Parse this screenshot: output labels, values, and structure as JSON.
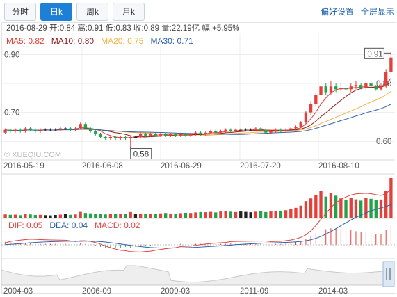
{
  "tabs": [
    {
      "label": "分时",
      "active": false
    },
    {
      "label": "日k",
      "active": true
    },
    {
      "label": "周k",
      "active": false
    },
    {
      "label": "月k",
      "active": false
    }
  ],
  "links": {
    "preferences": "偏好设置",
    "fullscreen": "全屏显示"
  },
  "info": {
    "date": "2016-08-29",
    "open_label": "开:",
    "open": "0.84",
    "high_label": "高:",
    "high": "0.91",
    "low_label": "低:",
    "low": "0.83",
    "close_label": "收:",
    "close": "0.89",
    "volume_label": "量:",
    "volume": "22.19亿",
    "change_label": "幅:",
    "change": "+5.95%"
  },
  "ma": [
    {
      "label": "MA5: 0.82",
      "color": "#e0413b"
    },
    {
      "label": "MA10: 0.80",
      "color": "#8b1a1a"
    },
    {
      "label": "MA20: 0.75",
      "color": "#f5b041"
    },
    {
      "label": "MA30: 0.71",
      "color": "#2e5fa8"
    }
  ],
  "macd": [
    {
      "label": "DIF: 0.05",
      "color": "#e0413b"
    },
    {
      "label": "DEA: 0.04",
      "color": "#2e5fa8"
    },
    {
      "label": "MACD: 0.02",
      "color": "#e0413b"
    }
  ],
  "watermark": "© XUEQIU.COM",
  "colors": {
    "up": "#e0413b",
    "down": "#22a34a",
    "flat": "#222222",
    "grid": "#ececec"
  },
  "chart_data": {
    "type": "candlestick",
    "ylim": [
      0.55,
      0.93
    ],
    "y_ticks": [
      0.9,
      0.8,
      0.7,
      0.6
    ],
    "y_tick_labels": [
      "0.90",
      "0.80",
      "0.70",
      "0.60"
    ],
    "x_tick_labels": [
      "2016-05-19",
      "2016-06-08",
      "2016-06-29",
      "2016-07-20",
      "2016-08-10"
    ],
    "markers": {
      "max": "0.91",
      "min": "0.58"
    },
    "bottom_axis_labels": [
      "2004-03",
      "2006-09",
      "2009-03",
      "2011-09",
      "2014-03"
    ],
    "candles": [
      [
        0.63,
        0.64,
        0.625,
        0.645
      ],
      [
        0.64,
        0.635,
        0.63,
        0.645
      ],
      [
        0.635,
        0.64,
        0.63,
        0.645
      ],
      [
        0.64,
        0.635,
        0.63,
        0.645
      ],
      [
        0.635,
        0.645,
        0.63,
        0.65
      ],
      [
        0.645,
        0.64,
        0.635,
        0.65
      ],
      [
        0.64,
        0.635,
        0.63,
        0.645
      ],
      [
        0.635,
        0.64,
        0.63,
        0.645
      ],
      [
        0.64,
        0.64,
        0.635,
        0.645
      ],
      [
        0.64,
        0.64,
        0.635,
        0.645
      ],
      [
        0.64,
        0.64,
        0.635,
        0.645
      ],
      [
        0.64,
        0.645,
        0.635,
        0.65
      ],
      [
        0.645,
        0.645,
        0.64,
        0.65
      ],
      [
        0.645,
        0.64,
        0.635,
        0.65
      ],
      [
        0.64,
        0.645,
        0.635,
        0.65
      ],
      [
        0.645,
        0.66,
        0.64,
        0.665
      ],
      [
        0.66,
        0.645,
        0.64,
        0.665
      ],
      [
        0.645,
        0.635,
        0.63,
        0.65
      ],
      [
        0.635,
        0.625,
        0.62,
        0.64
      ],
      [
        0.625,
        0.615,
        0.61,
        0.63
      ],
      [
        0.615,
        0.61,
        0.605,
        0.62
      ],
      [
        0.61,
        0.615,
        0.605,
        0.62
      ],
      [
        0.615,
        0.61,
        0.605,
        0.62
      ],
      [
        0.61,
        0.615,
        0.605,
        0.62
      ],
      [
        0.615,
        0.61,
        0.605,
        0.62
      ],
      [
        0.61,
        0.615,
        0.58,
        0.62
      ],
      [
        0.615,
        0.615,
        0.61,
        0.62
      ],
      [
        0.615,
        0.625,
        0.61,
        0.63
      ],
      [
        0.625,
        0.62,
        0.615,
        0.63
      ],
      [
        0.62,
        0.625,
        0.615,
        0.63
      ],
      [
        0.625,
        0.62,
        0.615,
        0.63
      ],
      [
        0.62,
        0.625,
        0.615,
        0.63
      ],
      [
        0.625,
        0.62,
        0.615,
        0.63
      ],
      [
        0.62,
        0.625,
        0.615,
        0.63
      ],
      [
        0.625,
        0.62,
        0.615,
        0.63
      ],
      [
        0.62,
        0.625,
        0.615,
        0.63
      ],
      [
        0.625,
        0.62,
        0.615,
        0.63
      ],
      [
        0.62,
        0.625,
        0.615,
        0.63
      ],
      [
        0.625,
        0.63,
        0.62,
        0.635
      ],
      [
        0.63,
        0.625,
        0.62,
        0.635
      ],
      [
        0.625,
        0.63,
        0.62,
        0.635
      ],
      [
        0.63,
        0.635,
        0.625,
        0.64
      ],
      [
        0.635,
        0.63,
        0.625,
        0.64
      ],
      [
        0.63,
        0.635,
        0.625,
        0.64
      ],
      [
        0.635,
        0.64,
        0.63,
        0.645
      ],
      [
        0.64,
        0.635,
        0.63,
        0.645
      ],
      [
        0.635,
        0.64,
        0.63,
        0.645
      ],
      [
        0.64,
        0.64,
        0.635,
        0.645
      ],
      [
        0.64,
        0.64,
        0.635,
        0.645
      ],
      [
        0.64,
        0.64,
        0.635,
        0.645
      ],
      [
        0.64,
        0.645,
        0.635,
        0.65
      ],
      [
        0.645,
        0.64,
        0.635,
        0.65
      ],
      [
        0.64,
        0.63,
        0.625,
        0.645
      ],
      [
        0.63,
        0.635,
        0.625,
        0.64
      ],
      [
        0.635,
        0.64,
        0.63,
        0.645
      ],
      [
        0.64,
        0.635,
        0.63,
        0.645
      ],
      [
        0.635,
        0.64,
        0.63,
        0.645
      ],
      [
        0.64,
        0.645,
        0.635,
        0.65
      ],
      [
        0.645,
        0.65,
        0.64,
        0.655
      ],
      [
        0.65,
        0.665,
        0.645,
        0.67
      ],
      [
        0.665,
        0.7,
        0.66,
        0.705
      ],
      [
        0.7,
        0.73,
        0.69,
        0.74
      ],
      [
        0.73,
        0.76,
        0.72,
        0.77
      ],
      [
        0.76,
        0.79,
        0.75,
        0.8
      ],
      [
        0.79,
        0.77,
        0.76,
        0.8
      ],
      [
        0.77,
        0.79,
        0.76,
        0.81
      ],
      [
        0.79,
        0.78,
        0.77,
        0.8
      ],
      [
        0.78,
        0.785,
        0.77,
        0.8
      ],
      [
        0.785,
        0.78,
        0.77,
        0.795
      ],
      [
        0.78,
        0.79,
        0.77,
        0.8
      ],
      [
        0.79,
        0.795,
        0.78,
        0.81
      ],
      [
        0.795,
        0.785,
        0.78,
        0.8
      ],
      [
        0.785,
        0.8,
        0.78,
        0.81
      ],
      [
        0.8,
        0.79,
        0.78,
        0.81
      ],
      [
        0.79,
        0.78,
        0.775,
        0.795
      ],
      [
        0.78,
        0.79,
        0.775,
        0.8
      ],
      [
        0.79,
        0.84,
        0.785,
        0.85
      ],
      [
        0.84,
        0.89,
        0.83,
        0.91
      ]
    ],
    "volumes": [
      22,
      20,
      21,
      18,
      24,
      22,
      19,
      20,
      18,
      17,
      19,
      21,
      23,
      20,
      22,
      36,
      30,
      28,
      26,
      24,
      22,
      25,
      23,
      27,
      26,
      35,
      24,
      26,
      25,
      27,
      26,
      28,
      30,
      27,
      26,
      29,
      31,
      30,
      33,
      35,
      34,
      36,
      33,
      38,
      40,
      37,
      35,
      38,
      36,
      34,
      37,
      39,
      35,
      38,
      40,
      42,
      45,
      50,
      58,
      70,
      95,
      110,
      130,
      150,
      120,
      140,
      125,
      110,
      100,
      115,
      105,
      98,
      112,
      108,
      100,
      104,
      150,
      222
    ],
    "macd_bars": [
      0.003,
      0.003,
      0.002,
      0.002,
      0.002,
      0.002,
      0.001,
      0.001,
      0.001,
      0.001,
      0.001,
      0.001,
      0.001,
      0,
      0,
      0.002,
      0.001,
      0,
      -0.001,
      -0.002,
      -0.003,
      -0.003,
      -0.003,
      -0.003,
      -0.002,
      -0.003,
      -0.002,
      -0.002,
      -0.001,
      -0.001,
      0,
      0,
      0,
      0,
      0,
      0.001,
      0,
      0,
      0.001,
      0.001,
      0.001,
      0.001,
      0.001,
      0.001,
      0.001,
      0.002,
      0.001,
      0.001,
      0.001,
      0.001,
      0.001,
      0.001,
      0.001,
      0,
      0.001,
      0.001,
      0.002,
      0.002,
      0.003,
      0.004,
      0.006,
      0.009,
      0.012,
      0.015,
      0.016,
      0.017,
      0.017,
      0.016,
      0.015,
      0.015,
      0.014,
      0.013,
      0.013,
      0.012,
      0.011,
      0.011,
      0.015,
      0.02
    ]
  }
}
